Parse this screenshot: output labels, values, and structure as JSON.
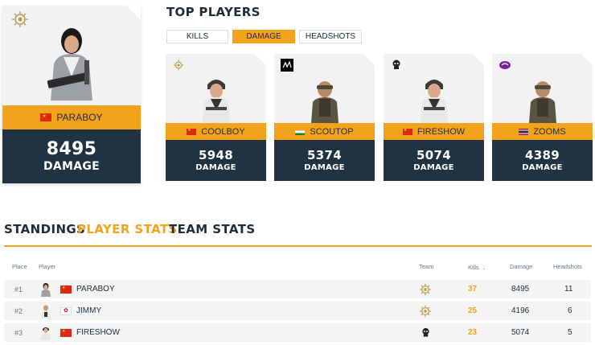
{
  "leader": {
    "name": "PARABOY",
    "value": "8495",
    "unit": "DAMAGE",
    "flag": "china",
    "team_icon": "sun-emblem-icon"
  },
  "top_players": {
    "title": "TOP PLAYERS",
    "filters": [
      {
        "label": "KILLS",
        "active": false
      },
      {
        "label": "DAMAGE",
        "active": true
      },
      {
        "label": "HEADSHOTS",
        "active": false
      }
    ],
    "cards": [
      {
        "name": "COOLBOY",
        "value": "5948",
        "unit": "DAMAGE",
        "flag": "china",
        "team_icon": "sun-emblem-icon"
      },
      {
        "name": "SCOUTOP",
        "value": "5374",
        "unit": "DAMAGE",
        "flag": "india",
        "team_icon": "signature-logo-icon"
      },
      {
        "name": "FIRESHOW",
        "value": "5074",
        "unit": "DAMAGE",
        "flag": "china",
        "team_icon": "skull-logo-icon"
      },
      {
        "name": "ZOOMS",
        "value": "4389",
        "unit": "DAMAGE",
        "flag": "thailand",
        "team_icon": "purple-swirl-logo-icon"
      }
    ]
  },
  "sections": [
    {
      "label": "STANDINGS",
      "active": false
    },
    {
      "label": "PLAYER STATS",
      "active": true
    },
    {
      "label": "TEAM STATS",
      "active": false
    }
  ],
  "table": {
    "headers": {
      "place": "Place",
      "player": "Player",
      "team": "Team",
      "kills": "Kills",
      "damage": "Damage",
      "headshots": "Headshots"
    },
    "sort_icon": "sort-down-arrow-icon",
    "rows": [
      {
        "place": "#1",
        "name": "PARABOY",
        "flag": "china",
        "team_icon": "sun-emblem-icon",
        "kills": "37",
        "damage": "8495",
        "headshots": "11"
      },
      {
        "place": "#2",
        "name": "JIMMY",
        "flag": "taiwan",
        "team_icon": "sun-emblem-icon",
        "kills": "25",
        "damage": "4196",
        "headshots": "6"
      },
      {
        "place": "#3",
        "name": "FIRESHOW",
        "flag": "china",
        "team_icon": "skull-logo-icon",
        "kills": "23",
        "damage": "5074",
        "headshots": "5"
      }
    ]
  },
  "colors": {
    "accent": "#f2a31b",
    "navy": "#213243",
    "text": "#1f2d3a"
  }
}
